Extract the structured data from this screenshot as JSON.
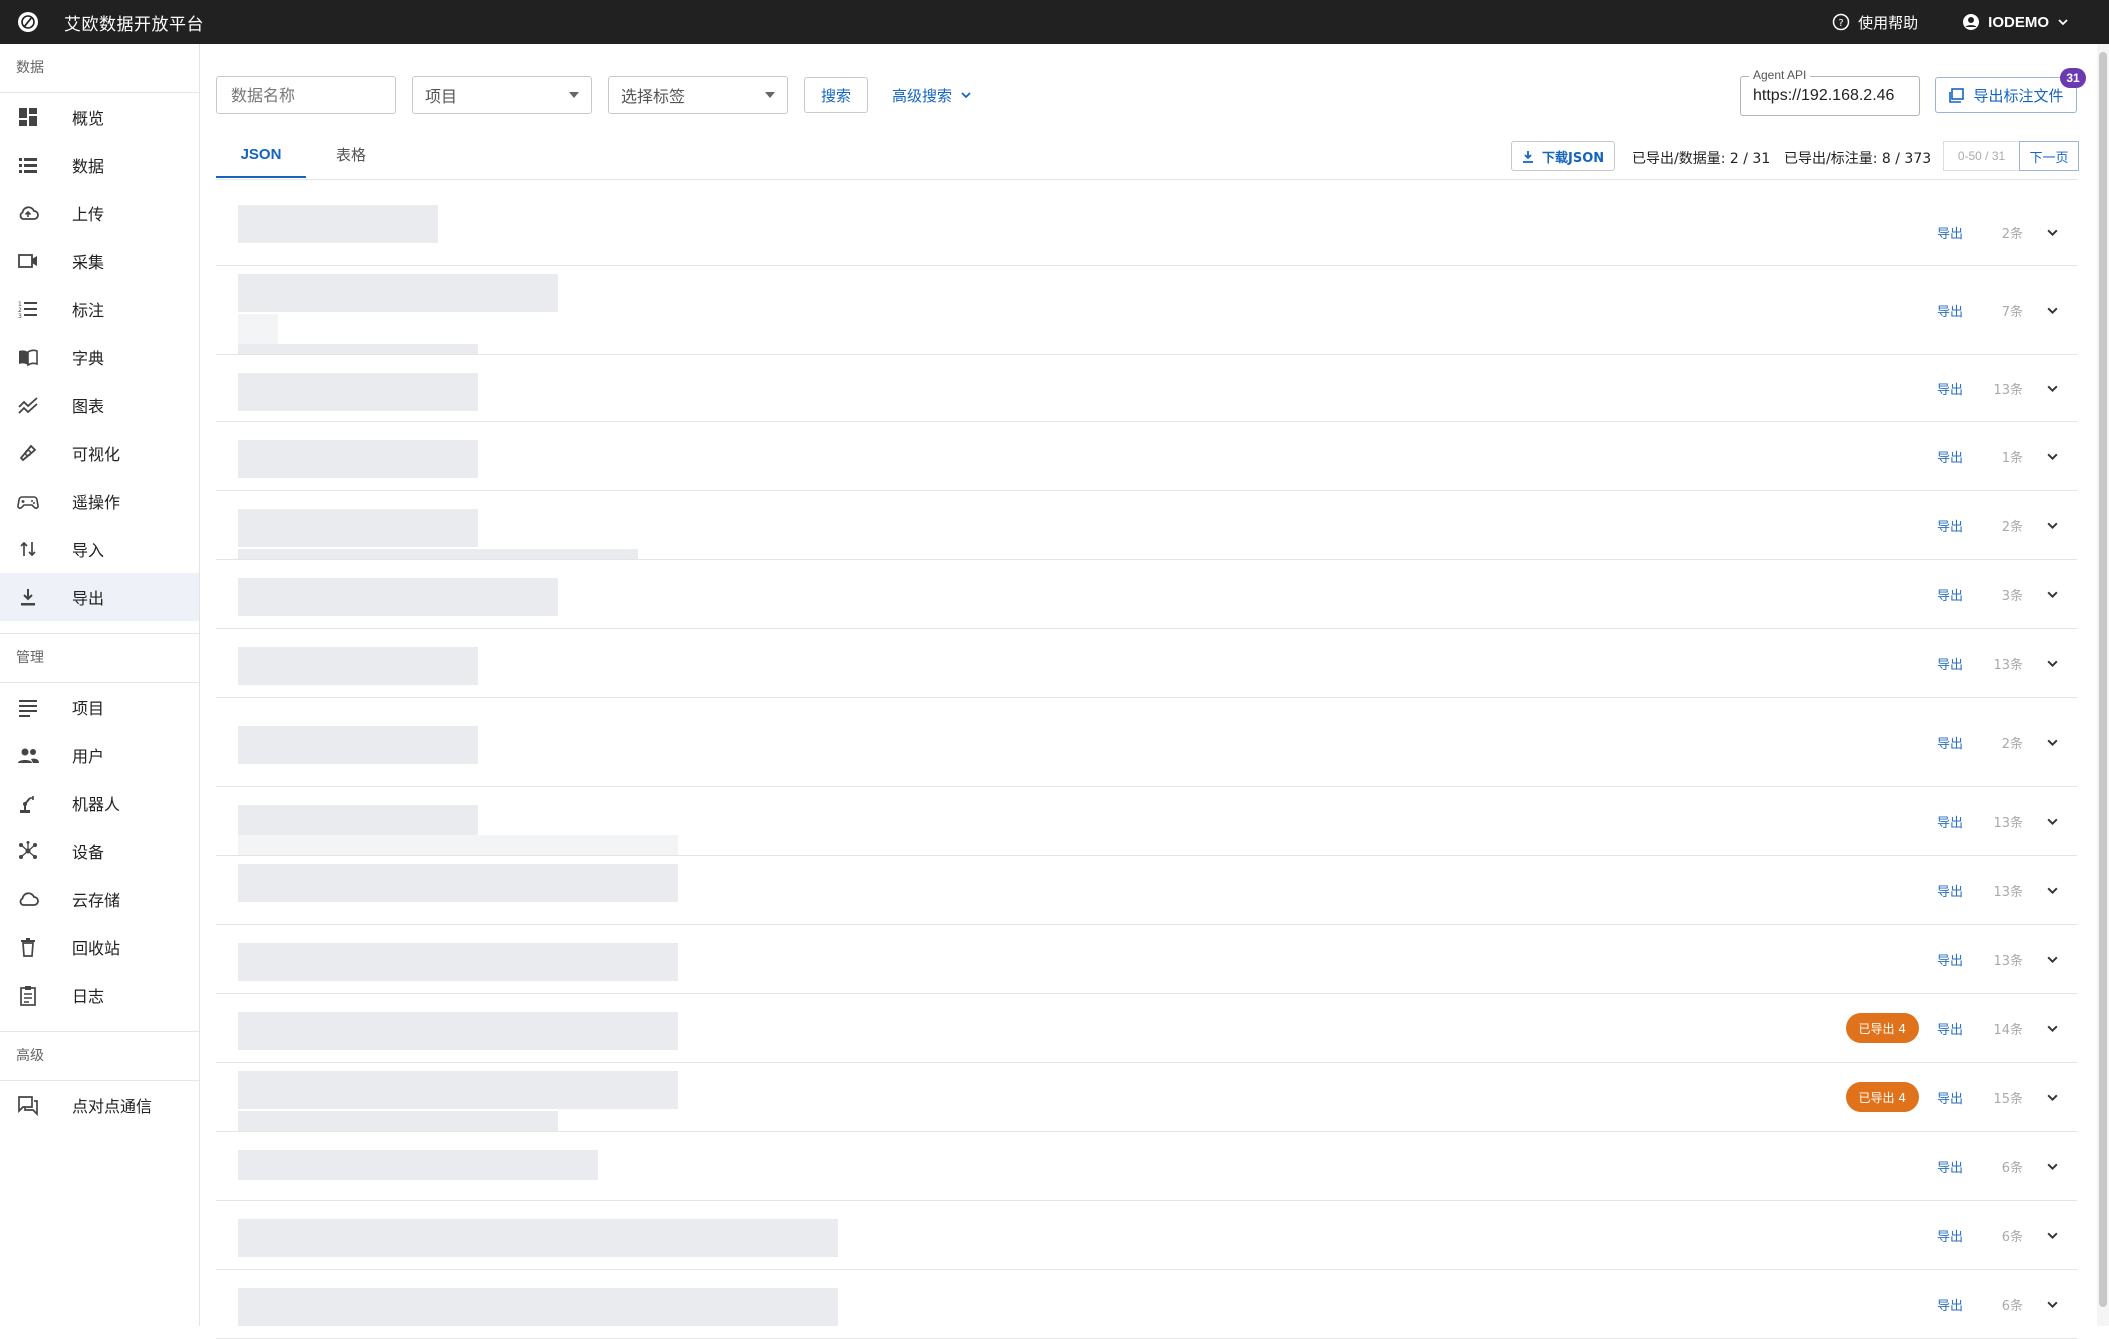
{
  "app": {
    "title": "艾欧数据开放平台",
    "help": "使用帮助",
    "user": "IODEMO"
  },
  "sidebar": {
    "sections": [
      {
        "label": "数据",
        "items": [
          {
            "label": "概览",
            "icon": "dashboard-icon"
          },
          {
            "label": "数据",
            "icon": "list-icon"
          },
          {
            "label": "上传",
            "icon": "cloud-upload-icon"
          },
          {
            "label": "采集",
            "icon": "video-camera-icon"
          },
          {
            "label": "标注",
            "icon": "numbered-list-icon"
          },
          {
            "label": "字典",
            "icon": "book-icon"
          },
          {
            "label": "图表",
            "icon": "chart-line-icon"
          },
          {
            "label": "可视化",
            "icon": "eye-icon"
          },
          {
            "label": "遥操作",
            "icon": "gamepad-icon"
          },
          {
            "label": "导入",
            "icon": "import-icon"
          },
          {
            "label": "导出",
            "icon": "download-icon",
            "active": true
          }
        ]
      },
      {
        "label": "管理",
        "items": [
          {
            "label": "项目",
            "icon": "subject-icon"
          },
          {
            "label": "用户",
            "icon": "users-icon"
          },
          {
            "label": "机器人",
            "icon": "robot-arm-icon"
          },
          {
            "label": "设备",
            "icon": "network-icon"
          },
          {
            "label": "云存储",
            "icon": "cloud-icon"
          },
          {
            "label": "回收站",
            "icon": "trash-icon"
          },
          {
            "label": "日志",
            "icon": "clipboard-icon"
          }
        ]
      },
      {
        "label": "高级",
        "items": [
          {
            "label": "点对点通信",
            "icon": "chat-icon"
          }
        ]
      }
    ]
  },
  "toolbar": {
    "name_placeholder": "数据名称",
    "project_select": "项目",
    "tag_select": "选择标签",
    "search_label": "搜索",
    "advanced_search": "高级搜索",
    "agent_api_label": "Agent API",
    "agent_api_value": "https://192.168.2.46",
    "export_file_label": "导出标注文件",
    "export_file_badge": "31"
  },
  "tabs": [
    {
      "label": "JSON",
      "active": true
    },
    {
      "label": "表格",
      "active": false
    }
  ],
  "summary": {
    "download_json": "下载JSON",
    "exported_data": "已导出/数据量: 2 / 31",
    "exported_annotations": "已导出/标注量: 8 / 373",
    "pager_range": "0-50 / 31",
    "next_page": "下一页"
  },
  "rows": [
    {
      "count": "2条",
      "export": "导出",
      "exported": ""
    },
    {
      "count": "7条",
      "export": "导出",
      "exported": ""
    },
    {
      "count": "13条",
      "export": "导出",
      "exported": ""
    },
    {
      "count": "1条",
      "export": "导出",
      "exported": ""
    },
    {
      "count": "2条",
      "export": "导出",
      "exported": ""
    },
    {
      "count": "3条",
      "export": "导出",
      "exported": ""
    },
    {
      "count": "13条",
      "export": "导出",
      "exported": ""
    },
    {
      "count": "2条",
      "export": "导出",
      "exported": ""
    },
    {
      "count": "13条",
      "export": "导出",
      "exported": ""
    },
    {
      "count": "13条",
      "export": "导出",
      "exported": ""
    },
    {
      "count": "13条",
      "export": "导出",
      "exported": ""
    },
    {
      "count": "14条",
      "export": "导出",
      "exported": "已导出 4"
    },
    {
      "count": "15条",
      "export": "导出",
      "exported": "已导出 4"
    },
    {
      "count": "6条",
      "export": "导出",
      "exported": ""
    },
    {
      "count": "6条",
      "export": "导出",
      "exported": ""
    },
    {
      "count": "6条",
      "export": "导出",
      "exported": ""
    }
  ]
}
